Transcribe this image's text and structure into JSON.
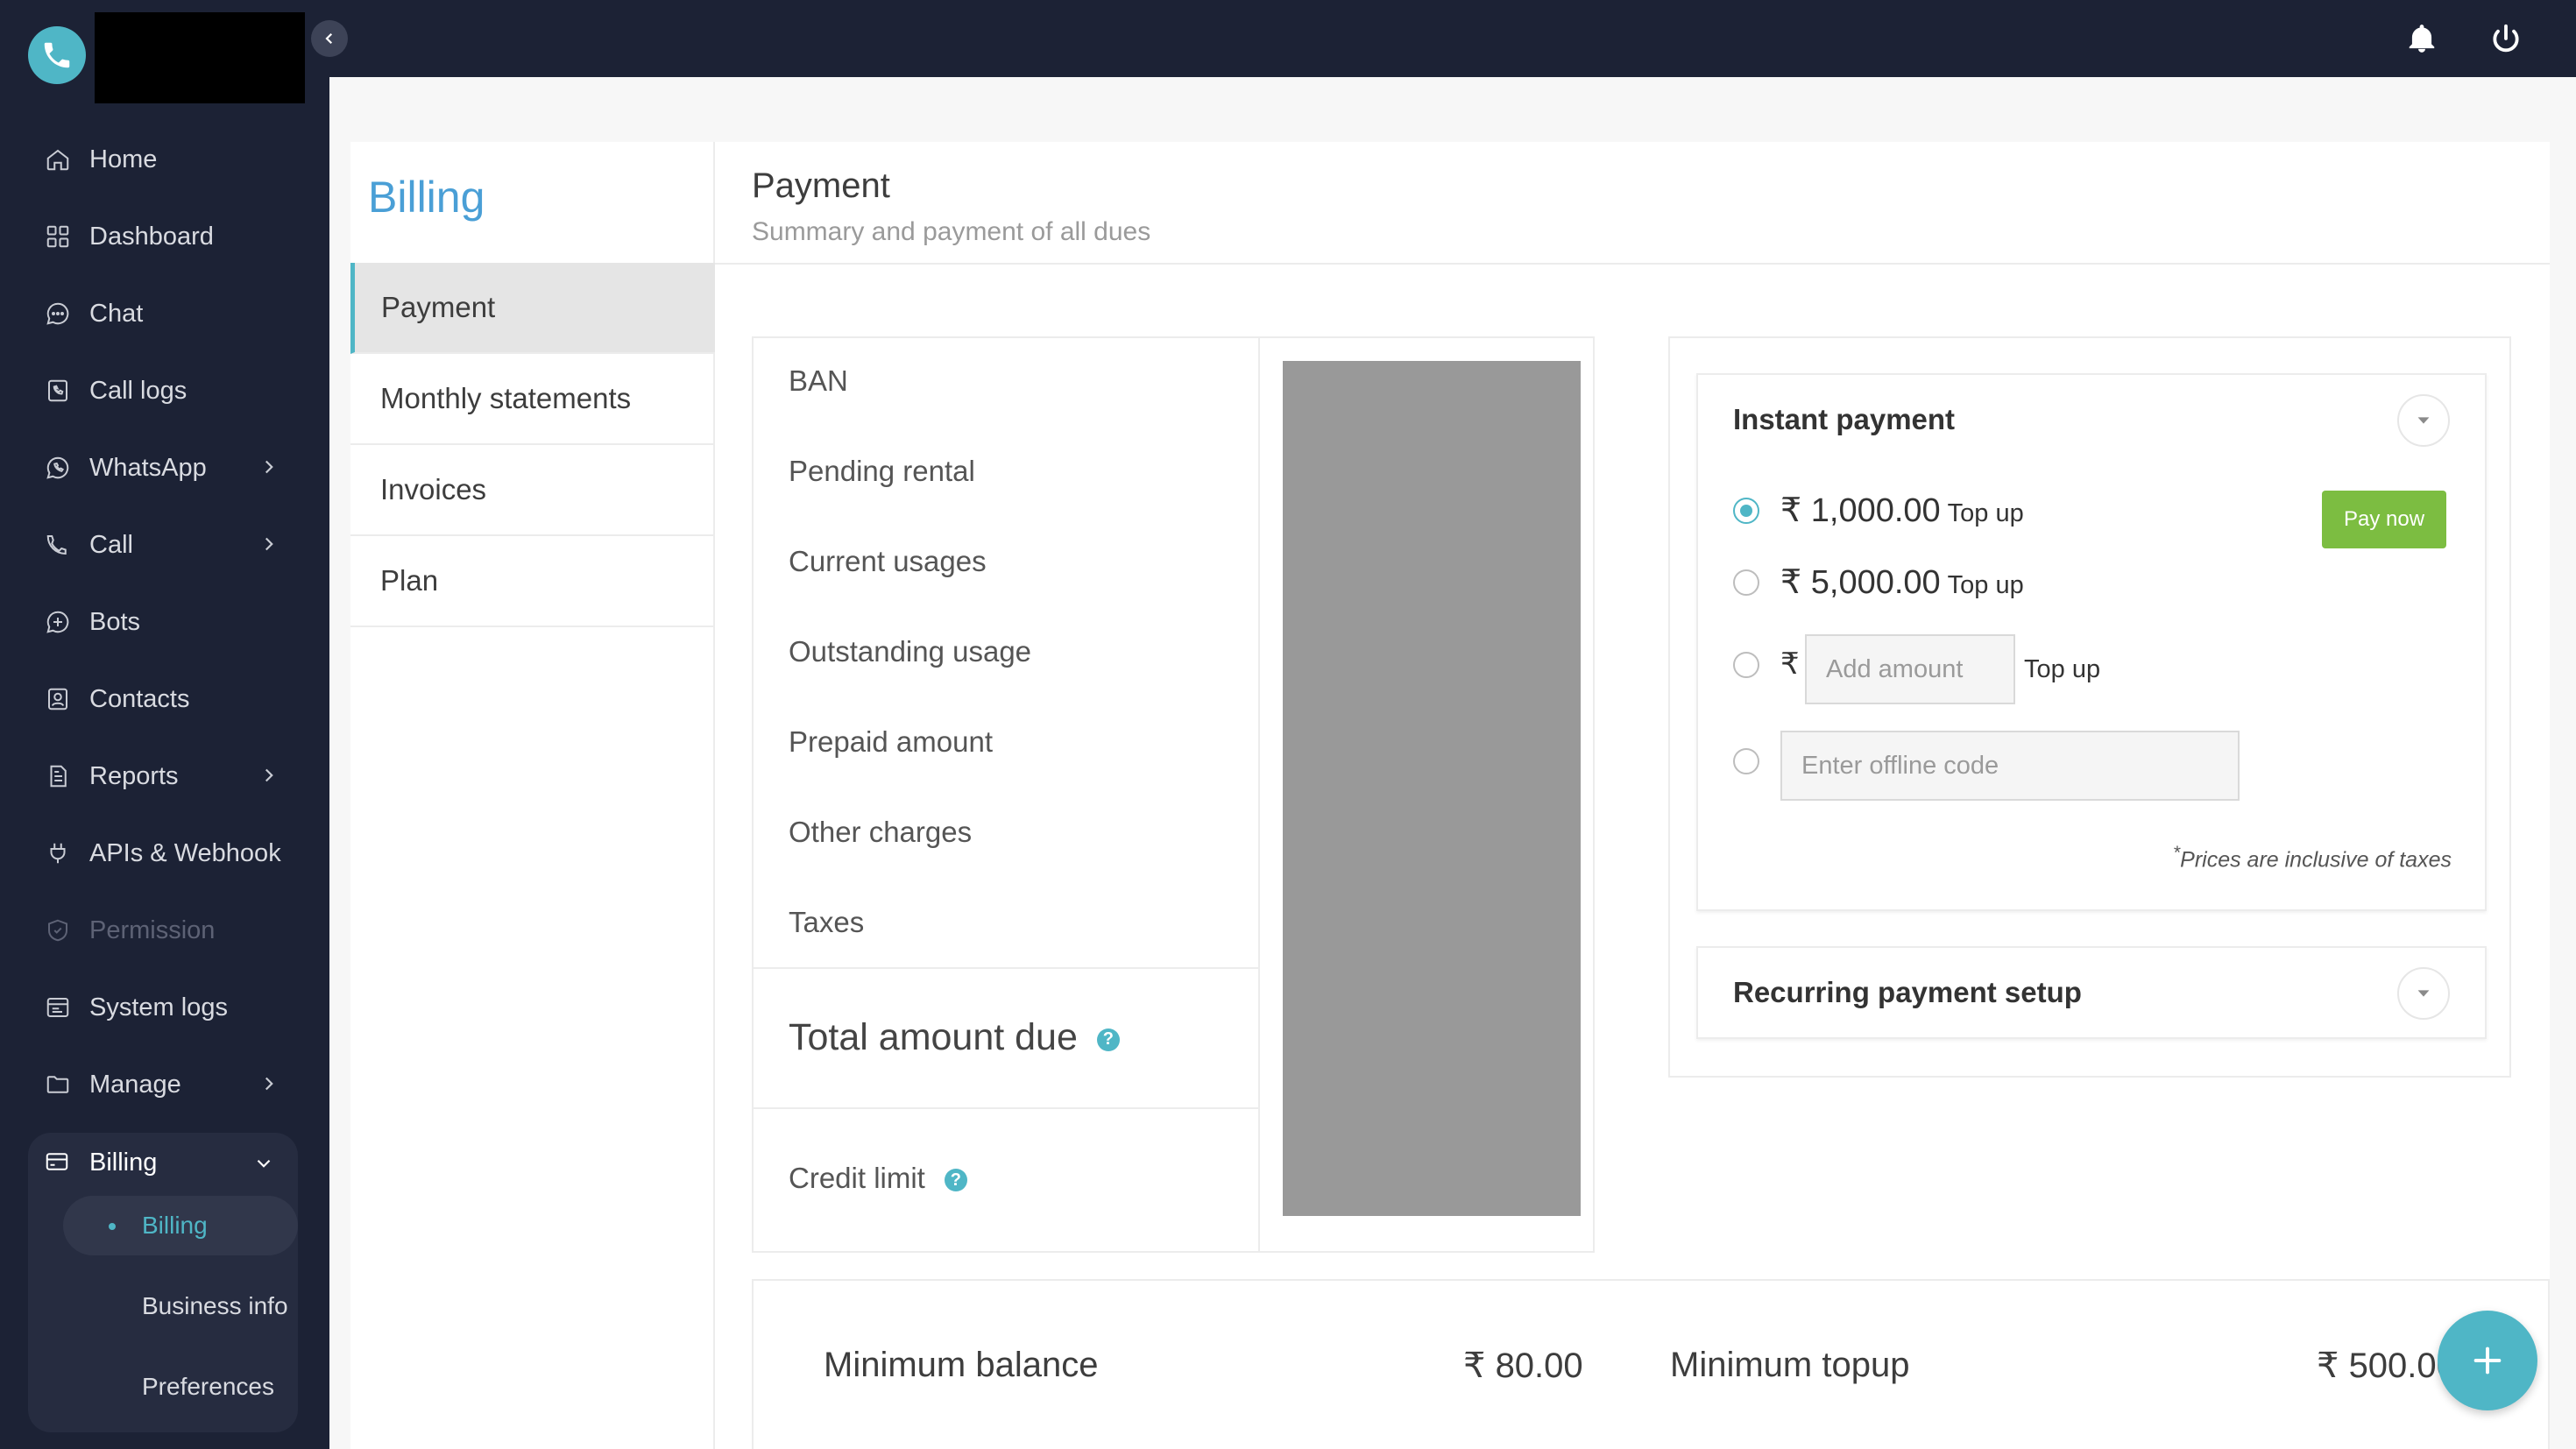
{
  "sidebar": {
    "items": [
      {
        "label": "Home",
        "icon": "home-icon"
      },
      {
        "label": "Dashboard",
        "icon": "dashboard-icon"
      },
      {
        "label": "Chat",
        "icon": "chat-icon"
      },
      {
        "label": "Call logs",
        "icon": "call-logs-icon"
      },
      {
        "label": "WhatsApp",
        "icon": "whatsapp-icon"
      },
      {
        "label": "Call",
        "icon": "call-icon"
      },
      {
        "label": "Bots",
        "icon": "bots-icon"
      },
      {
        "label": "Contacts",
        "icon": "contacts-icon"
      },
      {
        "label": "Reports",
        "icon": "reports-icon"
      },
      {
        "label": "APIs & Webhook",
        "icon": "plug-icon"
      },
      {
        "label": "Permission",
        "icon": "shield-icon"
      },
      {
        "label": "System logs",
        "icon": "system-logs-icon"
      },
      {
        "label": "Manage",
        "icon": "folder-icon"
      }
    ],
    "billing": {
      "label": "Billing",
      "sub_items": [
        "Billing",
        "Business info",
        "Preferences"
      ]
    }
  },
  "billing_menu": {
    "title": "Billing",
    "items": [
      "Payment",
      "Monthly statements",
      "Invoices",
      "Plan"
    ]
  },
  "payment": {
    "title": "Payment",
    "subtitle": "Summary and payment of all dues",
    "summary_labels": [
      "BAN",
      "Pending rental",
      "Current usages",
      "Outstanding usage",
      "Prepaid amount",
      "Other charges",
      "Taxes"
    ],
    "total_label": "Total amount due",
    "credit_label": "Credit limit"
  },
  "instant_payment": {
    "title": "Instant payment",
    "currency": "₹",
    "option1_amount": "1,000.00",
    "option2_amount": "5,000.00",
    "topup_label": "Top up",
    "pay_now": "Pay now",
    "add_amount_placeholder": "Add amount",
    "offline_code_placeholder": "Enter offline code",
    "note_star": "*",
    "note": "Prices are inclusive of taxes"
  },
  "recurring": {
    "title": "Recurring payment setup"
  },
  "balances": {
    "min_balance_label": "Minimum balance",
    "min_balance_value": "₹ 80.00",
    "min_topup_label": "Minimum topup",
    "min_topup_value": "₹ 500.00"
  },
  "colors": {
    "sidebar_bg": "#1c2235",
    "accent": "#4fb6c6",
    "pay_button": "#7cbd41",
    "billing_title": "#4a9fd6"
  }
}
